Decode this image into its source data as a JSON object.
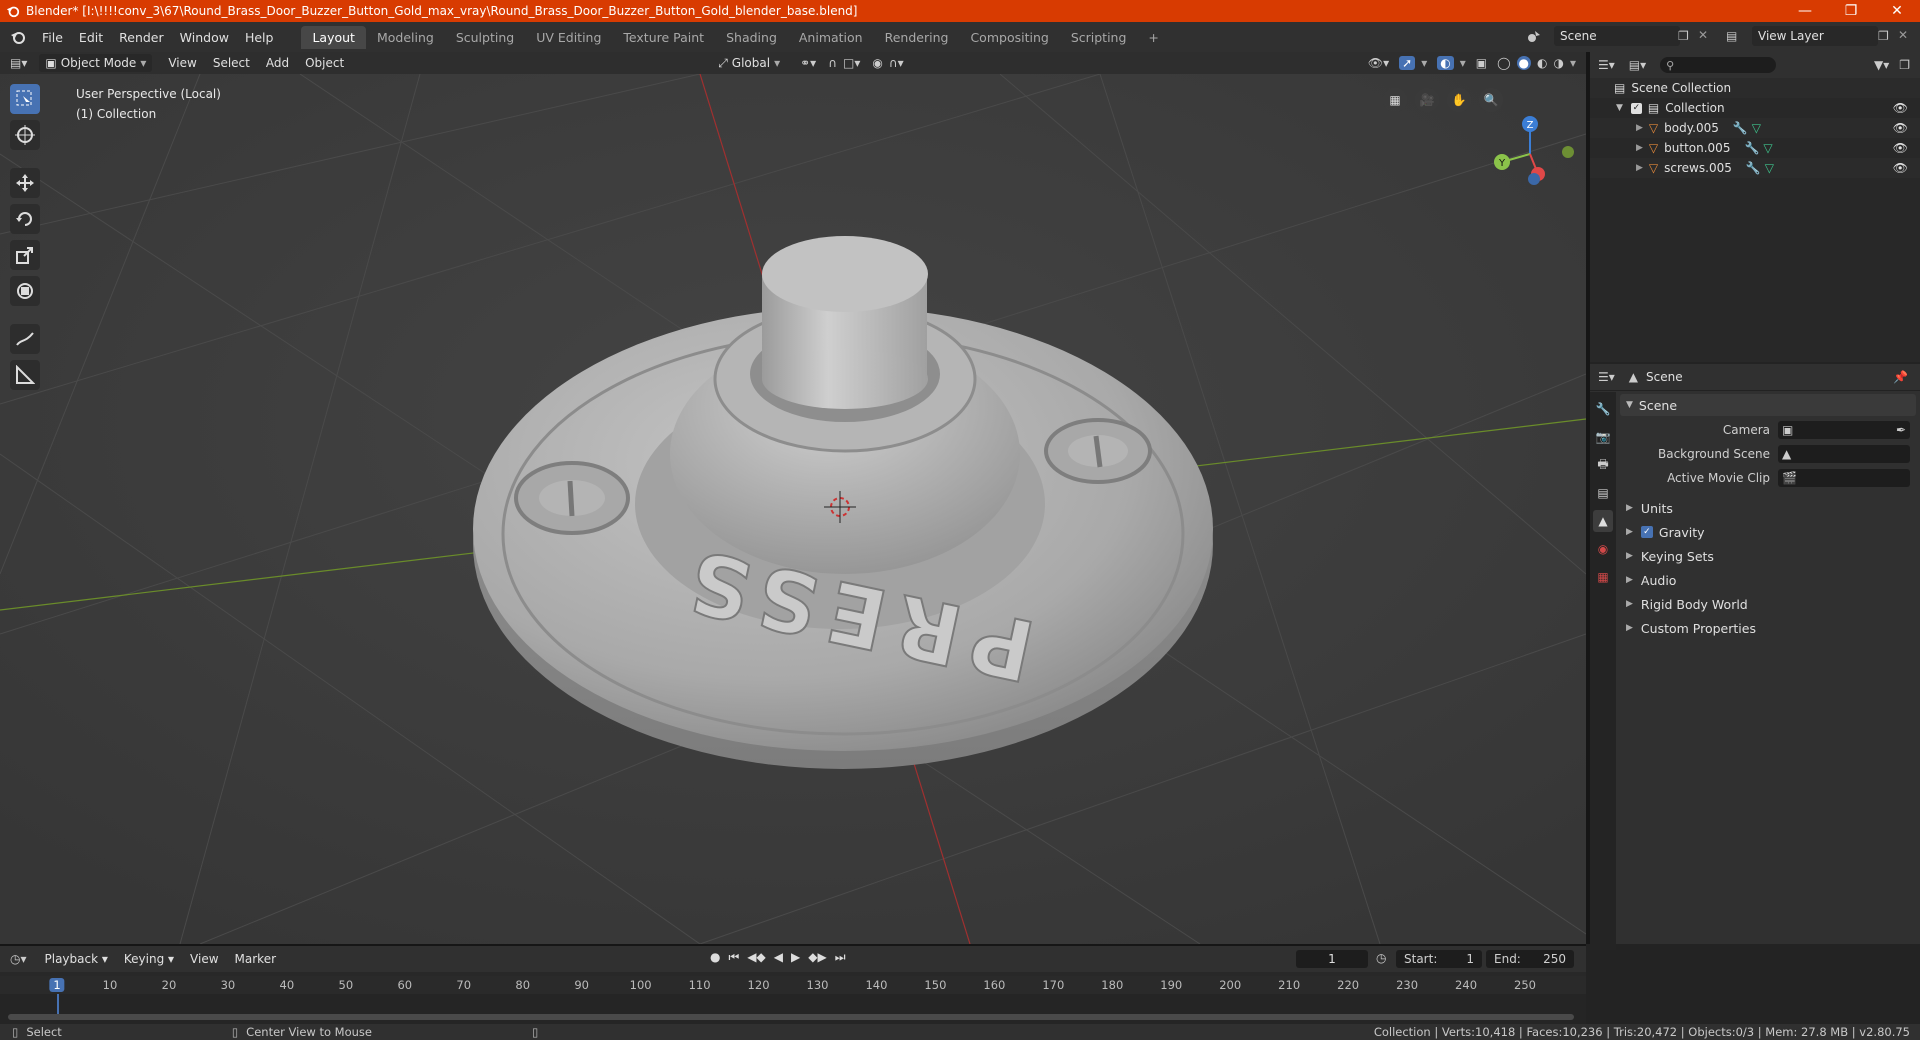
{
  "window": {
    "title": "Blender* [I:\\!!!!conv_3\\67\\Round_Brass_Door_Buzzer_Button_Gold_max_vray\\Round_Brass_Door_Buzzer_Button_Gold_blender_base.blend]",
    "accent": "#d83b01"
  },
  "menu": [
    "File",
    "Edit",
    "Render",
    "Window",
    "Help"
  ],
  "workspaces": [
    "Layout",
    "Modeling",
    "Sculpting",
    "UV Editing",
    "Texture Paint",
    "Shading",
    "Animation",
    "Rendering",
    "Compositing",
    "Scripting"
  ],
  "active_workspace": "Layout",
  "scene_name": "Scene",
  "view_layer": "View Layer",
  "viewport_header": {
    "mode": "Object Mode",
    "menus": [
      "View",
      "Select",
      "Add",
      "Object"
    ],
    "orientation": "Global"
  },
  "viewport": {
    "info_line1": "User Perspective (Local)",
    "info_line2": "(1) Collection",
    "model_text": "PRESS",
    "axis_z": "Z",
    "axis_y": "Y"
  },
  "outliner": {
    "root": "Scene Collection",
    "collection": "Collection",
    "objects": [
      "body.005",
      "button.005",
      "screws.005"
    ]
  },
  "properties": {
    "context": "Scene",
    "panel": "Scene",
    "fields": [
      "Camera",
      "Background Scene",
      "Active Movie Clip"
    ],
    "subpanels": [
      "Units",
      "Gravity",
      "Keying Sets",
      "Audio",
      "Rigid Body World",
      "Custom Properties"
    ],
    "gravity_checked": true
  },
  "timeline": {
    "menus": [
      "Playback",
      "Keying",
      "View",
      "Marker"
    ],
    "current_frame": "1",
    "start_label": "Start:",
    "start": "1",
    "end_label": "End:",
    "end": "250",
    "ticks": [
      "1",
      "10",
      "20",
      "30",
      "40",
      "50",
      "60",
      "70",
      "80",
      "90",
      "100",
      "110",
      "120",
      "130",
      "140",
      "150",
      "160",
      "170",
      "180",
      "190",
      "200",
      "210",
      "220",
      "230",
      "240",
      "250"
    ]
  },
  "statusbar": {
    "select": "Select",
    "center_view": "Center View to Mouse",
    "stats": "Collection | Verts:10,418 | Faces:10,236 | Tris:20,472 | Objects:0/3 | Mem: 27.8 MB | v2.80.75"
  }
}
